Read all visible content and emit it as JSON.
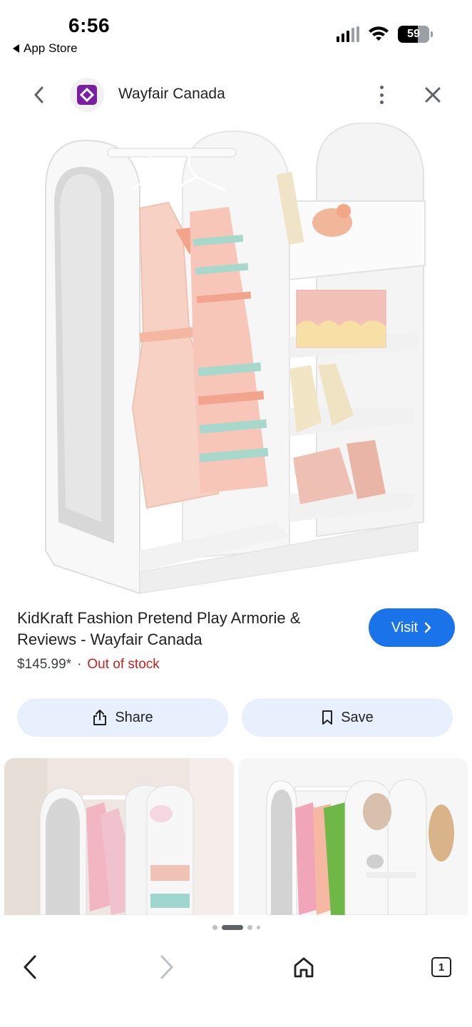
{
  "status_bar": {
    "time": "6:56",
    "back_app_label": "App Store",
    "battery_level": "59"
  },
  "header": {
    "site_name": "Wayfair Canada",
    "brand_color": "#7b1fa2"
  },
  "product": {
    "title": "KidKraft Fashion Pretend Play Armorie & Reviews - Wayfair Canada",
    "price": "$145.99*",
    "separator": "·",
    "stock_status": "Out of stock",
    "stock_color": "#c5221f"
  },
  "actions": {
    "visit_label": "Visit",
    "share_label": "Share",
    "save_label": "Save",
    "accent": "#1a73e8"
  },
  "pagination": {
    "current": 2,
    "total": 4
  },
  "toolbar": {
    "tab_count": "1",
    "icons": [
      "back-icon",
      "forward-icon",
      "home-icon",
      "tabs-icon"
    ]
  }
}
